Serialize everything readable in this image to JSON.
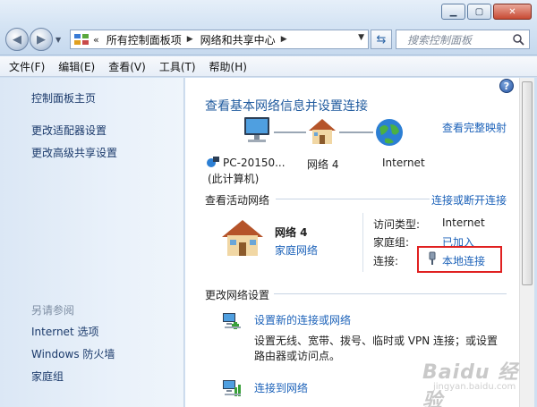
{
  "address": {
    "segments": [
      "所有控制面板项",
      "网络和共享中心"
    ],
    "chevron": "«"
  },
  "search": {
    "placeholder": "搜索控制面板"
  },
  "menu": [
    "文件(F)",
    "编辑(E)",
    "查看(V)",
    "工具(T)",
    "帮助(H)"
  ],
  "left_pane": {
    "links": [
      "控制面板主页",
      "更改适配器设置",
      "更改高级共享设置"
    ],
    "see_also_heading": "另请参阅",
    "see_also": [
      "Internet 选项",
      "Windows 防火墙",
      "家庭组"
    ]
  },
  "main": {
    "title": "查看基本网络信息并设置连接",
    "view_full_map": "查看完整映射",
    "map": {
      "computer_name": "PC-20150...",
      "computer_sub": "(此计算机)",
      "network": "网络  4",
      "internet": "Internet"
    },
    "active_networks": {
      "heading": "查看活动网络",
      "connect_disconnect": "连接或断开连接",
      "network_name": "网络  4",
      "network_type": "家庭网络",
      "access_type_label": "访问类型:",
      "access_type_value": "Internet",
      "homegroup_label": "家庭组:",
      "homegroup_value": "已加入",
      "connections_label": "连接:",
      "connections_value": "本地连接"
    },
    "change_settings": {
      "heading": "更改网络设置",
      "setup_link": "设置新的连接或网络",
      "setup_desc_line1": "设置无线、宽带、拨号、临时或 VPN 连接；或设置",
      "setup_desc_line2": "路由器或访问点。",
      "connect_link": "连接到网络"
    }
  },
  "watermark": {
    "main": "Baidu 经验",
    "sub": "jingyan.baidu.com"
  },
  "colors": {
    "link": "#1c62b9",
    "title": "#1f5a9e",
    "highlight_box": "#e02020"
  }
}
